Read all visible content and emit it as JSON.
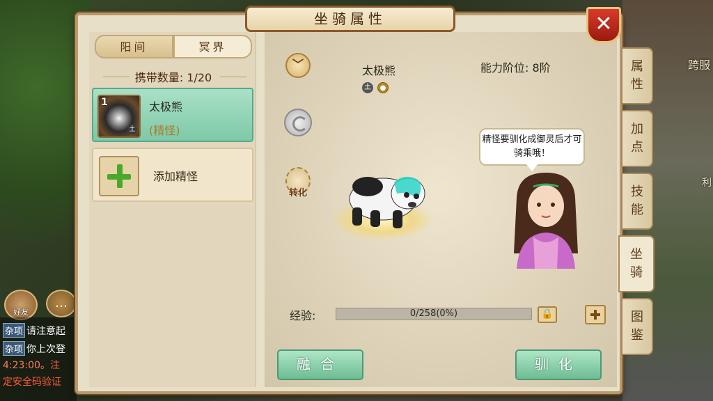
{
  "background": {
    "right_name": "跨服",
    "right_char": "利"
  },
  "chat": {
    "friend_label": "好友",
    "lines": [
      {
        "tag": "杂项",
        "text": "请注意起"
      },
      {
        "tag": "杂项",
        "text": "你上次登"
      },
      {
        "time": "4:23:00。",
        "text": "注"
      },
      {
        "text": "定安全码验证"
      }
    ]
  },
  "window": {
    "title": "坐骑属性",
    "close_symbol": "✕"
  },
  "left": {
    "tabs": [
      "阳间",
      "冥界"
    ],
    "capacity": "携带数量: 1/20",
    "mount": {
      "level": "1",
      "element": "土",
      "name": "太极熊",
      "type": "(精怪)"
    },
    "add_label": "添加精怪"
  },
  "detail": {
    "creature_name": "太极熊",
    "element_icons": [
      "earth-element-icon",
      "gold-emblem-icon"
    ],
    "element_text": "土",
    "ability": "能力阶位:  8阶",
    "convert_label": "转化",
    "speech": "精怪要驯化成御灵后才可骑乘哦！",
    "exp_label": "经验:",
    "exp_value": "0/258(0%)",
    "exp_progress": 0,
    "merge_label": "融合",
    "tame_label": "驯化"
  },
  "side_tabs": [
    {
      "label": "属性",
      "active": false
    },
    {
      "label": "加点",
      "active": false
    },
    {
      "label": "技能",
      "active": false
    },
    {
      "label": "坐骑",
      "active": true
    },
    {
      "label": "图鉴",
      "active": false
    }
  ],
  "colors": {
    "panel_bg": "#e8dfc9",
    "accent_green": "#7ec9a8",
    "frame_brown": "#8a5a2a",
    "close_red": "#d83a2a"
  }
}
